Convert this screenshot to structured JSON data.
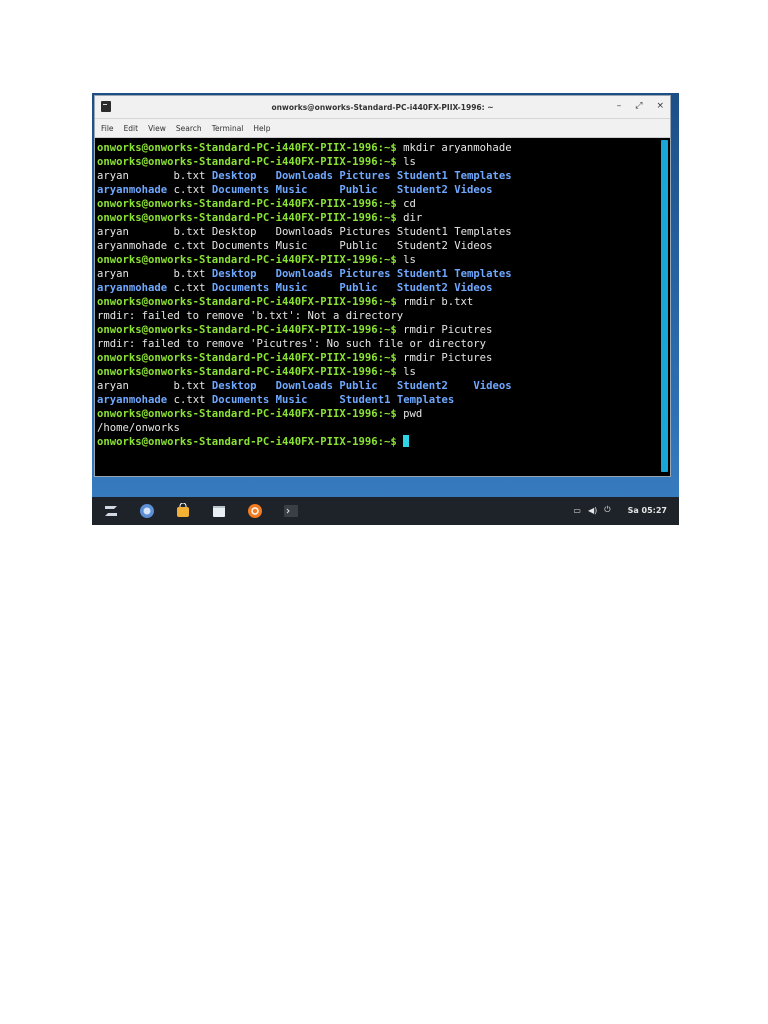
{
  "window": {
    "title": "onworks@onworks-Standard-PC-i440FX-PIIX-1996: ~",
    "controls": [
      "–",
      "⤢",
      "×"
    ]
  },
  "menu": [
    "File",
    "Edit",
    "View",
    "Search",
    "Terminal",
    "Help"
  ],
  "terminal": {
    "prompt": "onworks@onworks-Standard-PC-i440FX-PIIX-1996:~$",
    "lines": [
      {
        "prompt": true,
        "cmd": " mkdir aryanmohade"
      },
      {
        "prompt": true,
        "cmd": " ls"
      },
      {
        "cols": [
          {
            "t": "aryan",
            "d": false
          },
          {
            "t": "b.txt",
            "d": false
          },
          {
            "t": "Desktop",
            "d": true
          },
          {
            "t": "Downloads",
            "d": true
          },
          {
            "t": "Pictures",
            "d": true
          },
          {
            "t": "Student1",
            "d": true
          },
          {
            "t": "Templates",
            "d": true
          }
        ]
      },
      {
        "cols": [
          {
            "t": "aryanmohade",
            "d": true
          },
          {
            "t": "c.txt",
            "d": false
          },
          {
            "t": "Documents",
            "d": true
          },
          {
            "t": "Music",
            "d": true
          },
          {
            "t": "Public",
            "d": true
          },
          {
            "t": "Student2",
            "d": true
          },
          {
            "t": "Videos",
            "d": true
          }
        ]
      },
      {
        "prompt": true,
        "cmd": " cd"
      },
      {
        "prompt": true,
        "cmd": " dir"
      },
      {
        "cols": [
          {
            "t": "aryan",
            "d": false
          },
          {
            "t": "b.txt",
            "d": false
          },
          {
            "t": "Desktop",
            "d": false
          },
          {
            "t": "Downloads",
            "d": false
          },
          {
            "t": "Pictures",
            "d": false
          },
          {
            "t": "Student1",
            "d": false
          },
          {
            "t": "Templates",
            "d": false
          }
        ]
      },
      {
        "cols": [
          {
            "t": "aryanmohade",
            "d": false
          },
          {
            "t": "c.txt",
            "d": false
          },
          {
            "t": "Documents",
            "d": false
          },
          {
            "t": "Music",
            "d": false
          },
          {
            "t": "Public",
            "d": false
          },
          {
            "t": "Student2",
            "d": false
          },
          {
            "t": "Videos",
            "d": false
          }
        ]
      },
      {
        "prompt": true,
        "cmd": " ls"
      },
      {
        "cols": [
          {
            "t": "aryan",
            "d": false
          },
          {
            "t": "b.txt",
            "d": false
          },
          {
            "t": "Desktop",
            "d": true
          },
          {
            "t": "Downloads",
            "d": true
          },
          {
            "t": "Pictures",
            "d": true
          },
          {
            "t": "Student1",
            "d": true
          },
          {
            "t": "Templates",
            "d": true
          }
        ]
      },
      {
        "cols": [
          {
            "t": "aryanmohade",
            "d": true
          },
          {
            "t": "c.txt",
            "d": false
          },
          {
            "t": "Documents",
            "d": true
          },
          {
            "t": "Music",
            "d": true
          },
          {
            "t": "Public",
            "d": true
          },
          {
            "t": "Student2",
            "d": true
          },
          {
            "t": "Videos",
            "d": true
          }
        ]
      },
      {
        "prompt": true,
        "cmd": " rmdir b.txt"
      },
      {
        "text": "rmdir: failed to remove 'b.txt': Not a directory"
      },
      {
        "prompt": true,
        "cmd": " rmdir Picutres"
      },
      {
        "text": "rmdir: failed to remove 'Picutres': No such file or directory"
      },
      {
        "prompt": true,
        "cmd": " rmdir Pictures"
      },
      {
        "prompt": true,
        "cmd": " ls"
      },
      {
        "cols5": [
          {
            "t": "aryan",
            "d": false
          },
          {
            "t": "b.txt",
            "d": false
          },
          {
            "t": "Desktop",
            "d": true
          },
          {
            "t": "Downloads",
            "d": true
          },
          {
            "t": "Public",
            "d": true
          },
          {
            "t": "Student2",
            "d": true
          },
          {
            "t": "Videos",
            "d": true
          }
        ]
      },
      {
        "cols5": [
          {
            "t": "aryanmohade",
            "d": true
          },
          {
            "t": "c.txt",
            "d": false
          },
          {
            "t": "Documents",
            "d": true
          },
          {
            "t": "Music",
            "d": true
          },
          {
            "t": "Student1",
            "d": true
          },
          {
            "t": "Templates",
            "d": true
          }
        ]
      },
      {
        "prompt": true,
        "cmd": " pwd"
      },
      {
        "text": "/home/onworks"
      },
      {
        "prompt": true,
        "cmd": " ",
        "cursor": true
      }
    ]
  },
  "taskbar": {
    "icons": [
      "zorin-menu-icon",
      "browser-icon",
      "software-store-icon",
      "files-icon",
      "settings-icon",
      "terminal-icon"
    ],
    "clock": "Sa 05:27"
  },
  "colors": {
    "prompt": "#8ae234",
    "directory": "#6fa8ff",
    "cursor": "#2fd3e6",
    "scrollbar": "#1aa6d6",
    "taskbar": "#1e2329"
  }
}
